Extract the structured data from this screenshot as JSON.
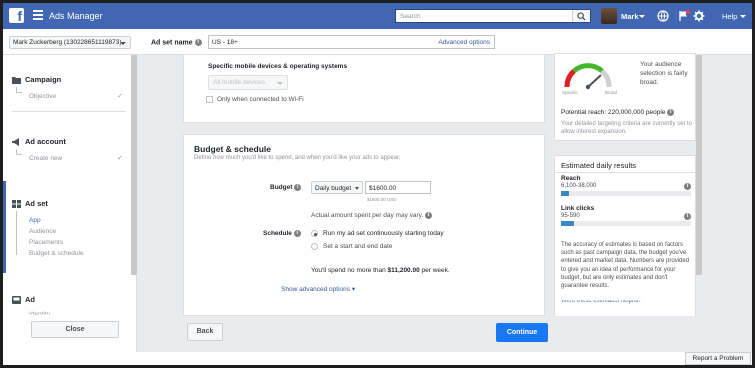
{
  "topbar": {
    "app_title": "Ads Manager",
    "search_placeholder": "Search",
    "user_name": "Mark",
    "help_label": "Help"
  },
  "subbar": {
    "account_selector": "Mark Zuckerberg (130228651119873)",
    "adset_name_label": "Ad set name",
    "adset_name_value": "US - 18+",
    "advanced_options": "Advanced options"
  },
  "sidebar": {
    "campaign": {
      "label": "Campaign",
      "sub": "Objective"
    },
    "ad_account": {
      "label": "Ad account",
      "sub": "Create new"
    },
    "ad_set": {
      "label": "Ad set",
      "items": [
        "App",
        "Audience",
        "Placements",
        "Budget & schedule"
      ]
    },
    "ad": {
      "label": "Ad",
      "sub": "Identity"
    },
    "close_label": "Close"
  },
  "devices": {
    "heading": "Specific mobile devices & operating systems",
    "dropdown": "All mobile devices",
    "wifi_label": "Only when connected to Wi-Fi"
  },
  "budget": {
    "title": "Budget & schedule",
    "description": "Define how much you'd like to spend, and when you'd like your ads to appear.",
    "budget_label": "Budget",
    "budget_type": "Daily budget",
    "budget_value": "$1600.00",
    "budget_hint": "$1600.00 USD",
    "vary_note": "Actual amount spent per day may vary.",
    "schedule_label": "Schedule",
    "schedule_options": [
      "Run my ad set continuously starting today",
      "Set a start and end date"
    ],
    "spend_prefix": "You'll spend no more than ",
    "spend_amount": "$11,200.00",
    "spend_suffix": " per week.",
    "show_advanced": "Show advanced options"
  },
  "audience_def": {
    "specific_label": "Specific",
    "broad_label": "Broad",
    "summary": "Your audience selection is fairly broad.",
    "potential_reach": "Potential reach: 220,000,000 people",
    "note": "Your detailed targeting criteria are currently set to allow interest expansion.",
    "gauge_level": 0.7
  },
  "estimates": {
    "title": "Estimated daily results",
    "reach_label": "Reach",
    "reach_value": "6,100-38,000",
    "reach_fill": 0.06,
    "clicks_label": "Link clicks",
    "clicks_value": "95-590",
    "clicks_fill": 0.1,
    "disclaimer": "The accuracy of estimates is based on factors such as past campaign data, the budget you've entered and market data. Numbers are provided to give you an idea of performance for your budget, but are only estimates and don't guarantee results.",
    "more_link": "Were these estimates helpful?"
  },
  "footer": {
    "back_label": "Back",
    "continue_label": "Continue",
    "report_label": "Report a Problem"
  },
  "colors": {
    "brand_blue": "#4267b2",
    "primary_button": "#1877f2",
    "bar_fill": "#3b87c3"
  }
}
